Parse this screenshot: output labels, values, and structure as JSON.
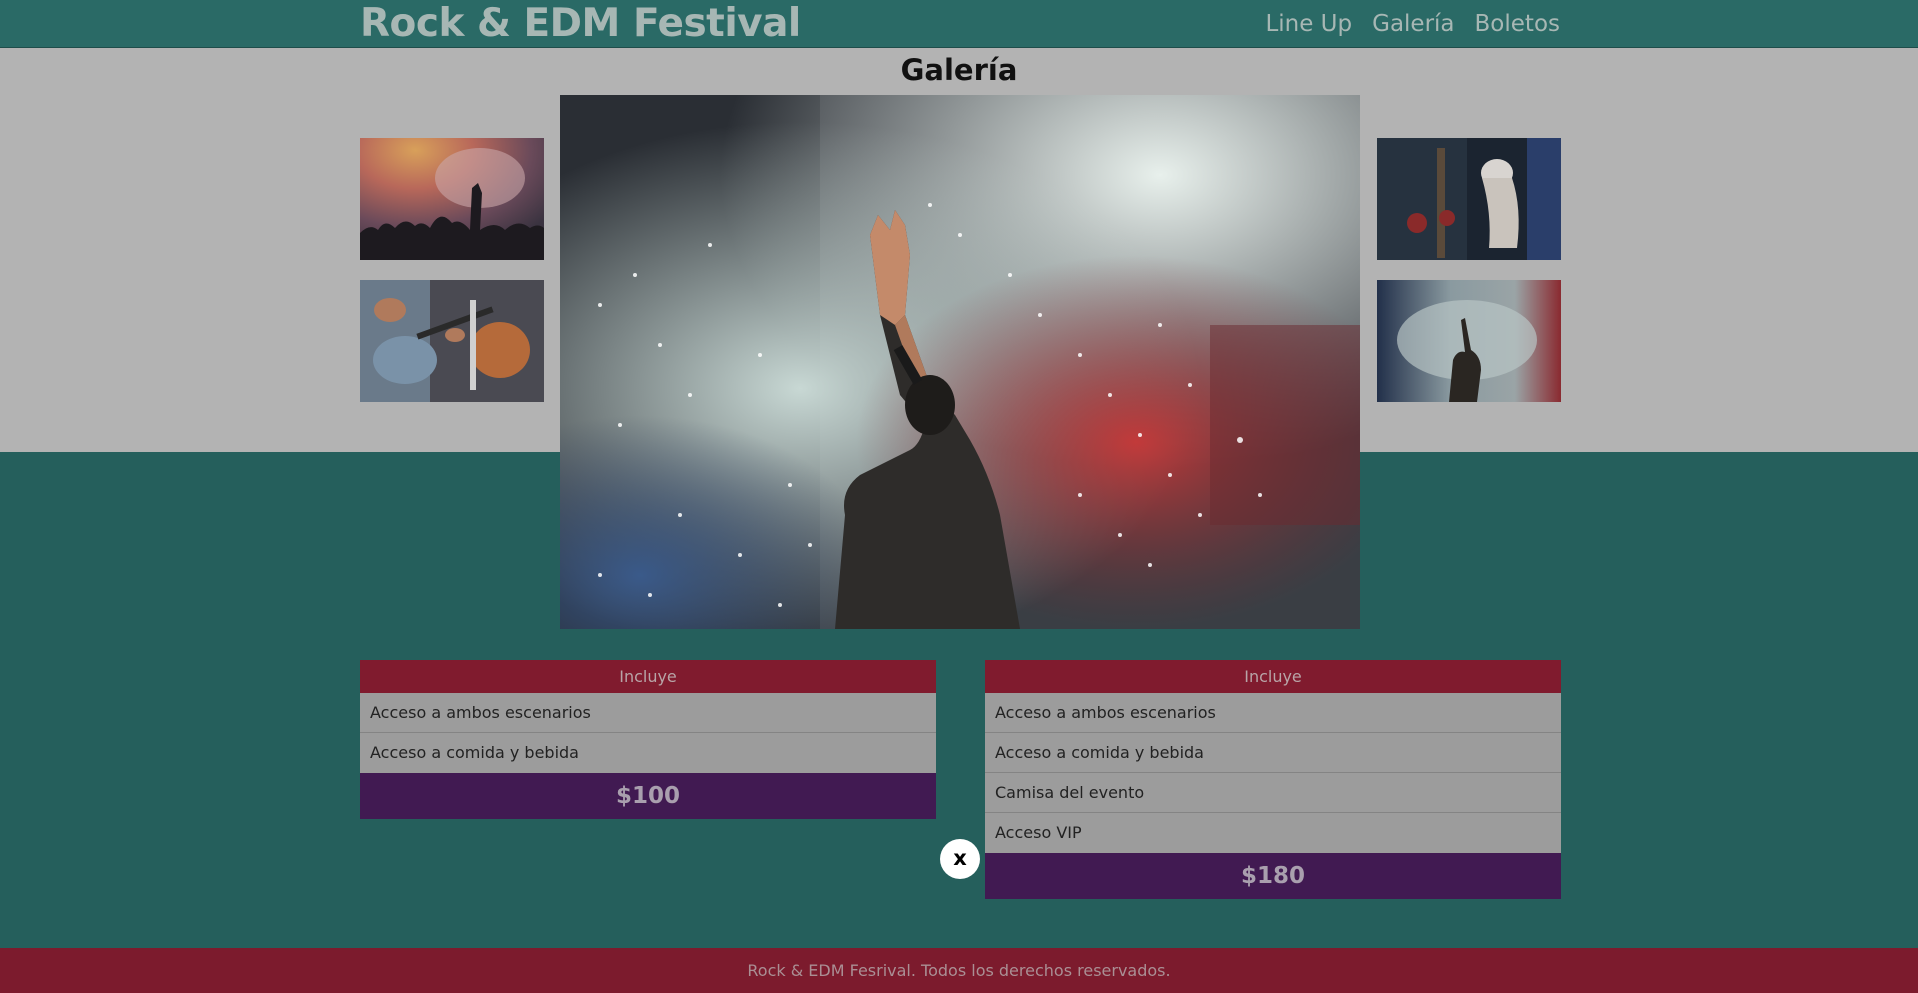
{
  "header": {
    "brand": "Rock & EDM Festival",
    "nav": [
      "Line Up",
      "Galería",
      "Boletos"
    ]
  },
  "gallery": {
    "title": "Galería",
    "thumbnails": [
      "crowd-photo",
      "guitarists-photo",
      "dj-photo",
      "performer-smoke-photo"
    ]
  },
  "tickets": [
    {
      "header": "Incluye",
      "features": [
        "Acceso a ambos escenarios",
        "Acceso a comida y bebida"
      ],
      "price": "$100"
    },
    {
      "header": "Incluye",
      "features": [
        "Acceso a ambos escenarios",
        "Acceso a comida y bebida",
        "Camisa del evento",
        "Acceso VIP"
      ],
      "price": "$180"
    }
  ],
  "footer": {
    "text": "Rock & EDM Fesrival. Todos los derechos reservados."
  },
  "lightbox": {
    "image": "performer-raising-hand-in-smoke",
    "close_label": "x"
  },
  "colors": {
    "header_bg": "#2a6a66",
    "section_bg": "#255f5c",
    "accent_red": "#801b2e",
    "price_purple": "#411a52",
    "footer_bg": "#7c1b2d"
  }
}
